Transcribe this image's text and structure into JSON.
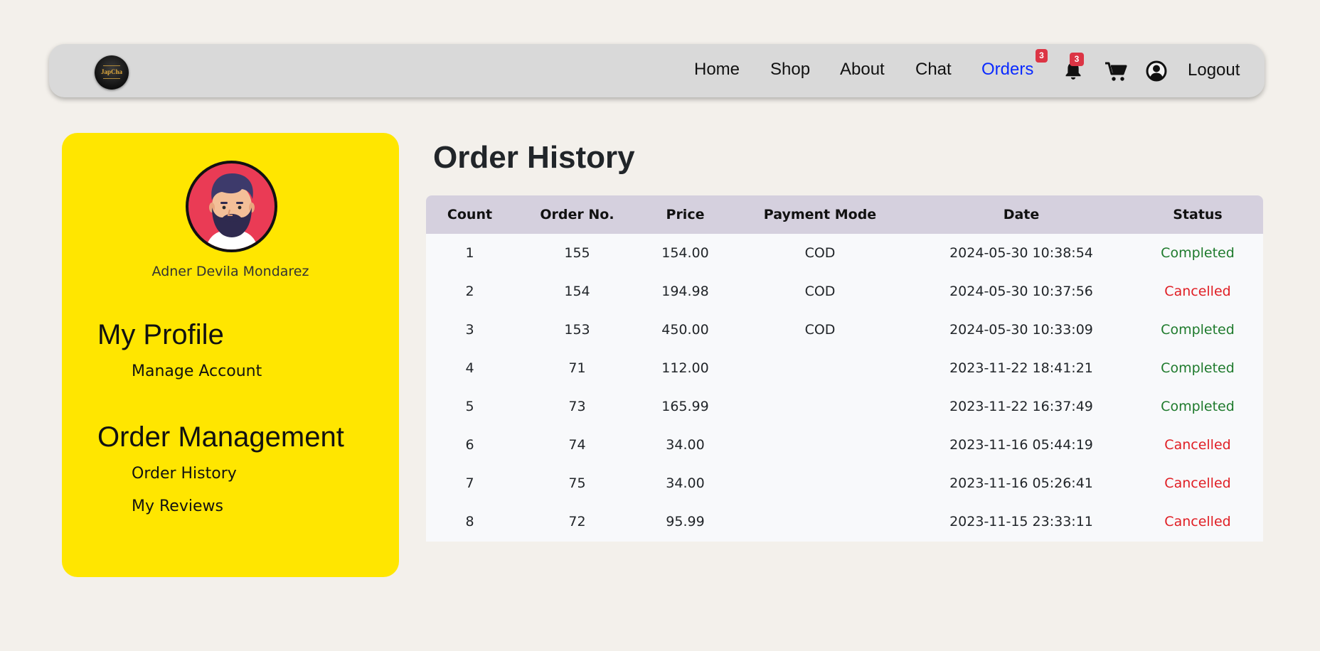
{
  "nav": {
    "logo_text": "JapCha",
    "links": [
      {
        "label": "Home"
      },
      {
        "label": "Shop"
      },
      {
        "label": "About"
      },
      {
        "label": "Chat"
      },
      {
        "label": "Orders",
        "badge": "3",
        "active": true
      }
    ],
    "notification_badge": "3",
    "logout_label": "Logout",
    "icons": [
      "bell-icon",
      "cart-icon",
      "user-circle-icon"
    ],
    "active_color": "#0a2aff"
  },
  "sidebar": {
    "user_name": "Adner Devila Mondarez",
    "profile_heading": "My Profile",
    "profile_links": [
      "Manage Account"
    ],
    "orders_heading": "Order Management",
    "orders_links": [
      "Order History",
      "My Reviews"
    ],
    "background": "#ffe600"
  },
  "main": {
    "title": "Order History",
    "columns": [
      "Count",
      "Order No.",
      "Price",
      "Payment Mode",
      "Date",
      "Status"
    ],
    "rows": [
      {
        "count": "1",
        "order_no": "155",
        "price": "154.00",
        "payment": "COD",
        "date": "2024-05-30 10:38:54",
        "status": "Completed"
      },
      {
        "count": "2",
        "order_no": "154",
        "price": "194.98",
        "payment": "COD",
        "date": "2024-05-30 10:37:56",
        "status": "Cancelled"
      },
      {
        "count": "3",
        "order_no": "153",
        "price": "450.00",
        "payment": "COD",
        "date": "2024-05-30 10:33:09",
        "status": "Completed"
      },
      {
        "count": "4",
        "order_no": "71",
        "price": "112.00",
        "payment": "",
        "date": "2023-11-22 18:41:21",
        "status": "Completed"
      },
      {
        "count": "5",
        "order_no": "73",
        "price": "165.99",
        "payment": "",
        "date": "2023-11-22 16:37:49",
        "status": "Completed"
      },
      {
        "count": "6",
        "order_no": "74",
        "price": "34.00",
        "payment": "",
        "date": "2023-11-16 05:44:19",
        "status": "Cancelled"
      },
      {
        "count": "7",
        "order_no": "75",
        "price": "34.00",
        "payment": "",
        "date": "2023-11-16 05:26:41",
        "status": "Cancelled"
      },
      {
        "count": "8",
        "order_no": "72",
        "price": "95.99",
        "payment": "",
        "date": "2023-11-15 23:33:11",
        "status": "Cancelled"
      }
    ],
    "status_colors": {
      "Completed": "#1e7a2c",
      "Cancelled": "#e01e24"
    }
  }
}
